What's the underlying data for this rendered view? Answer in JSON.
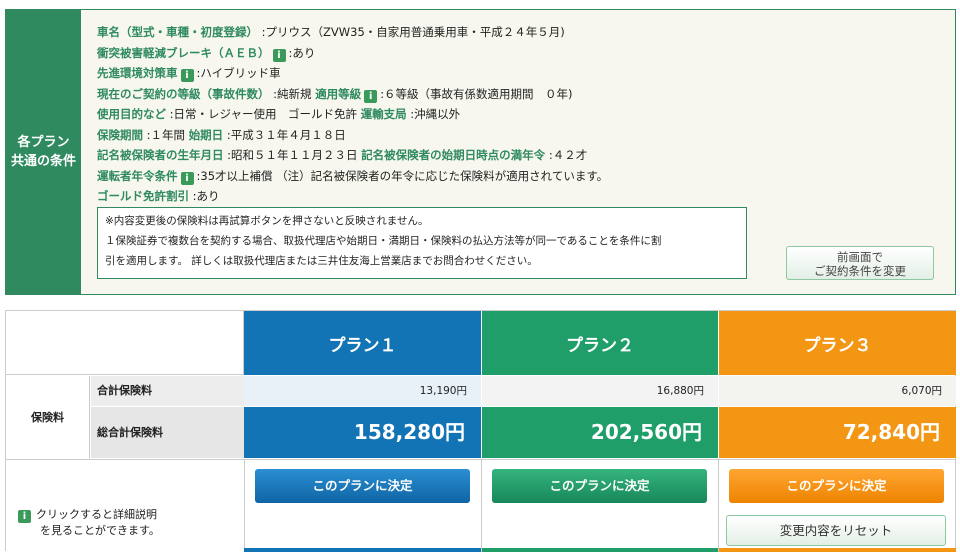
{
  "common": {
    "side_title_1": "各プラン",
    "side_title_2": "共通の条件",
    "rows": [
      {
        "label": "車名（型式・車種・初度登録）",
        "value": ":プリウス（ZVW35・自家用普通乗用車・平成２４年５月)"
      },
      {
        "label": "衝突被害軽減ブレーキ（ＡＥＢ）",
        "value": ":あり"
      },
      {
        "label": "先進環境対策車",
        "value": ":ハイブリッド車"
      },
      {
        "label": "現在のご契約の等級（事故件数）",
        "value": ":純新規",
        "label2": "適用等級",
        "value2": ":６等級（事故有係数適用期間　０年)"
      },
      {
        "label": "使用目的など",
        "value": ":日常・レジャー使用　ゴールド免許",
        "label2": "運輸支局",
        "value2": ":沖縄以外"
      },
      {
        "label": "保険期間",
        "value": ":１年間",
        "label2": "始期日",
        "value2": ":平成３１年４月１８日"
      },
      {
        "label": "記名被保険者の生年月日",
        "value": ":昭和５１年１１月２３日",
        "label2": "記名被保険者の始期日時点の満年令",
        "value2": ":４２才"
      },
      {
        "label": "運転者年令条件",
        "value": ":35才以上補償 （注）記名被保険者の年令に応じた保険料が適用されています。"
      },
      {
        "label": "ゴールド免許割引",
        "value": ":あり"
      }
    ],
    "note_1": "※内容変更後の保険料は再試算ボタンを押さないと反映されません。",
    "note_2": "１保険証券で複数台を契約する場合、取扱代理店や始期日・満期日・保険料の払込方法等が同一であることを条件に割",
    "note_3": "引を適用します。 詳しくは取扱代理店または三井住友海上営業店までお問合わせください。",
    "change_btn_1": "前画面で",
    "change_btn_2": "ご契約条件を変更",
    "info_icon": "i"
  },
  "table": {
    "premium_label": "保険料",
    "subtotal_label": "合計保険料",
    "total_label": "総合計保険料",
    "plans": [
      {
        "name": "プラン１",
        "subtotal": "13,190円",
        "total": "158,280円",
        "button": "このプランに決定",
        "color": "#1273b5"
      },
      {
        "name": "プラン２",
        "subtotal": "16,880円",
        "total": "202,560円",
        "button": "このプランに決定",
        "color": "#1f9e6a"
      },
      {
        "name": "プラン３",
        "subtotal": "6,070円",
        "total": "72,840円",
        "button": "このプランに決定",
        "color": "#f39613"
      }
    ],
    "hint_1": "クリックすると詳細説明",
    "hint_2": "を見ることができます。",
    "reset_button": "変更内容をリセット"
  }
}
